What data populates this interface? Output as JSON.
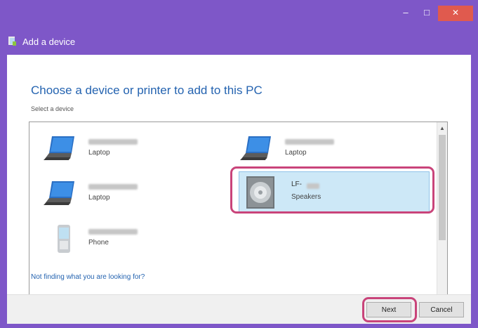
{
  "window": {
    "title": "Add a device",
    "minimize_glyph": "–",
    "maximize_glyph": "□",
    "close_glyph": "✕"
  },
  "main": {
    "heading": "Choose a device or printer to add to this PC",
    "subheading": "Select a device",
    "not_finding_link": "Not finding what you are looking for?"
  },
  "devices": [
    {
      "name": "",
      "type": "Laptop",
      "icon": "laptop-icon"
    },
    {
      "name": "",
      "type": "Laptop",
      "icon": "laptop-icon"
    },
    {
      "name": "",
      "type": "Laptop",
      "icon": "laptop-icon"
    },
    {
      "name": "LF-",
      "type": "Speakers",
      "icon": "speaker-icon",
      "selected": true
    },
    {
      "name": "",
      "type": "Phone",
      "icon": "phone-icon"
    }
  ],
  "buttons": {
    "next": "Next",
    "cancel": "Cancel"
  },
  "colors": {
    "titlebar": "#7e57c8",
    "close_button": "#e05a4e",
    "heading": "#2463b0",
    "selection": "#cde8f7",
    "highlight": "#c9447a"
  }
}
